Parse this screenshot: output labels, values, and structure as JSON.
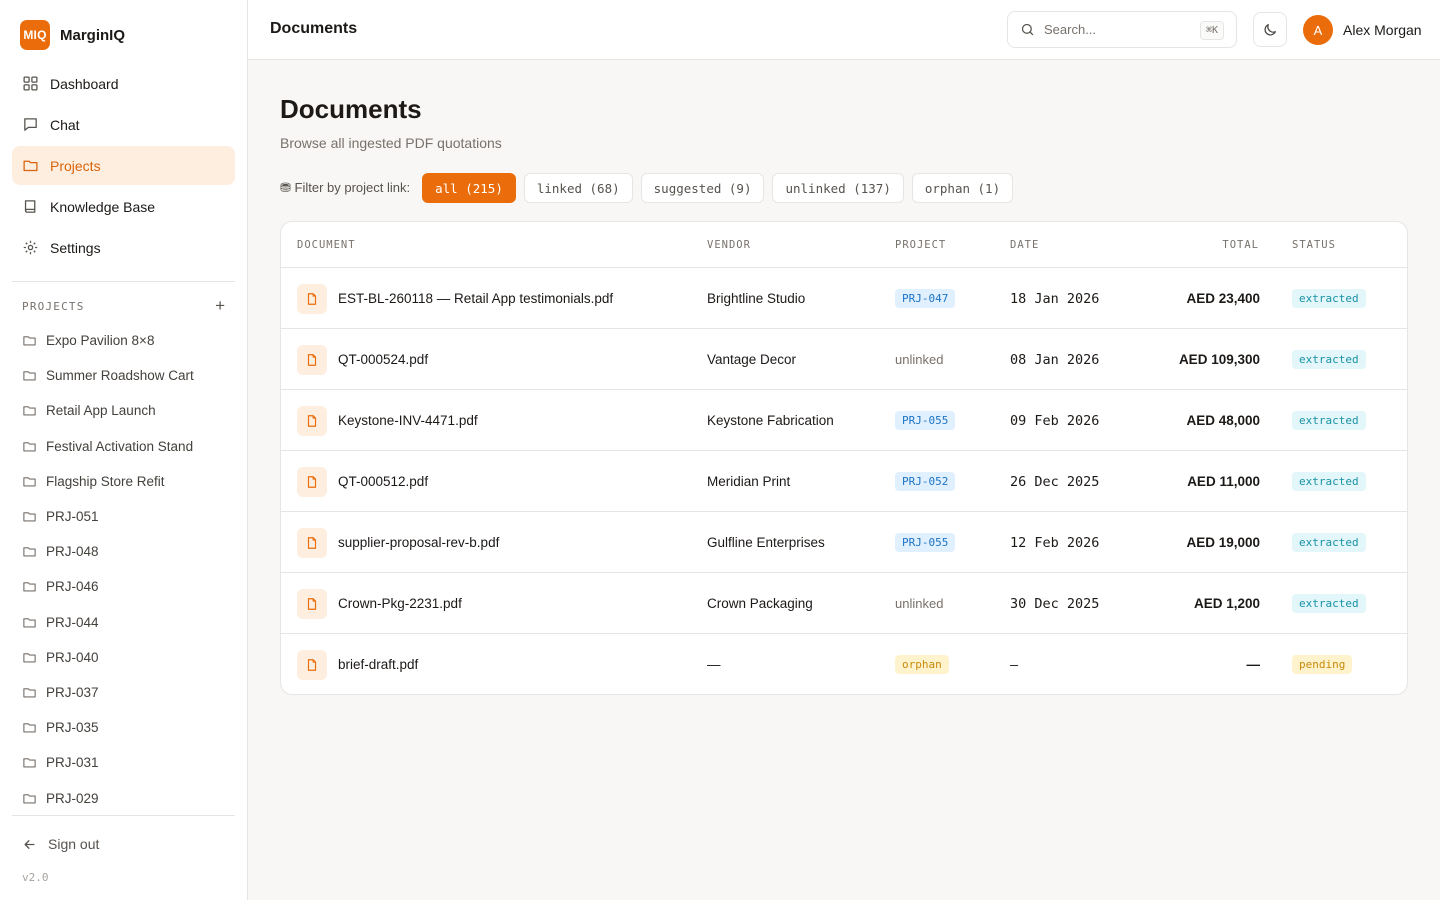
{
  "brand": {
    "logo": "MIQ",
    "name": "MarginIQ"
  },
  "nav": [
    {
      "label": "Dashboard",
      "icon": "grid-icon",
      "active": false
    },
    {
      "label": "Chat",
      "icon": "chat-icon",
      "active": false
    },
    {
      "label": "Projects",
      "icon": "folder-icon",
      "active": true
    },
    {
      "label": "Knowledge Base",
      "icon": "book-icon",
      "active": false
    },
    {
      "label": "Settings",
      "icon": "gear-icon",
      "active": false
    }
  ],
  "projects_section": {
    "label": "PROJECTS",
    "add_label": "+",
    "items": [
      "Expo Pavilion 8×8",
      "Summer Roadshow Cart",
      "Retail App Launch",
      "Festival Activation Stand",
      "Flagship Store Refit",
      "PRJ-051",
      "PRJ-048",
      "PRJ-046",
      "PRJ-044",
      "PRJ-040",
      "PRJ-037",
      "PRJ-035",
      "PRJ-031",
      "PRJ-029"
    ]
  },
  "footer": {
    "sign_out": "Sign out",
    "version": "v2.0"
  },
  "topbar": {
    "title": "Documents",
    "search_placeholder": "Search...",
    "search_shortcut": "⌘K",
    "user_initial": "A",
    "user_name": "Alex Morgan"
  },
  "main": {
    "title": "Documents",
    "subtitle": "Browse all ingested PDF quotations",
    "filter_label": "⛃ Filter by project link:",
    "filters": [
      {
        "label": "all (215)",
        "active": true
      },
      {
        "label": "linked (68)",
        "active": false
      },
      {
        "label": "suggested (9)",
        "active": false
      },
      {
        "label": "unlinked (137)",
        "active": false
      },
      {
        "label": "orphan (1)",
        "active": false
      }
    ]
  },
  "table": {
    "columns": [
      "DOCUMENT",
      "VENDOR",
      "PROJECT",
      "DATE",
      "TOTAL",
      "STATUS"
    ],
    "rows": [
      {
        "document": "EST-BL-260118 — Retail App testimonials.pdf",
        "vendor": "Brightline Studio",
        "project": "PRJ-047",
        "project_kind": "proj",
        "date": "18 Jan 2026",
        "total": "AED 23,400",
        "status": "extracted"
      },
      {
        "document": "QT-000524.pdf",
        "vendor": "Vantage Decor",
        "project": "unlinked",
        "project_kind": "unlinked",
        "date": "08 Jan 2026",
        "total": "AED 109,300",
        "status": "extracted"
      },
      {
        "document": "Keystone-INV-4471.pdf",
        "vendor": "Keystone Fabrication",
        "project": "PRJ-055",
        "project_kind": "proj",
        "date": "09 Feb 2026",
        "total": "AED 48,000",
        "status": "extracted"
      },
      {
        "document": "QT-000512.pdf",
        "vendor": "Meridian Print",
        "project": "PRJ-052",
        "project_kind": "proj",
        "date": "26 Dec 2025",
        "total": "AED 11,000",
        "status": "extracted"
      },
      {
        "document": "supplier-proposal-rev-b.pdf",
        "vendor": "Gulfline Enterprises",
        "project": "PRJ-055",
        "project_kind": "proj",
        "date": "12 Feb 2026",
        "total": "AED 19,000",
        "status": "extracted"
      },
      {
        "document": "Crown-Pkg-2231.pdf",
        "vendor": "Crown Packaging",
        "project": "unlinked",
        "project_kind": "unlinked",
        "date": "30 Dec 2025",
        "total": "AED 1,200",
        "status": "extracted"
      },
      {
        "document": "brief-draft.pdf",
        "vendor": "—",
        "project": "orphan",
        "project_kind": "orphan",
        "date": "—",
        "total": "—",
        "status": "pending"
      }
    ]
  },
  "colors": {
    "accent": "#ea6c0a",
    "accent_soft": "#fdeee0",
    "project_badge": "#1d74c4",
    "extracted": "#1893a6",
    "pending": "#c78a0a"
  }
}
